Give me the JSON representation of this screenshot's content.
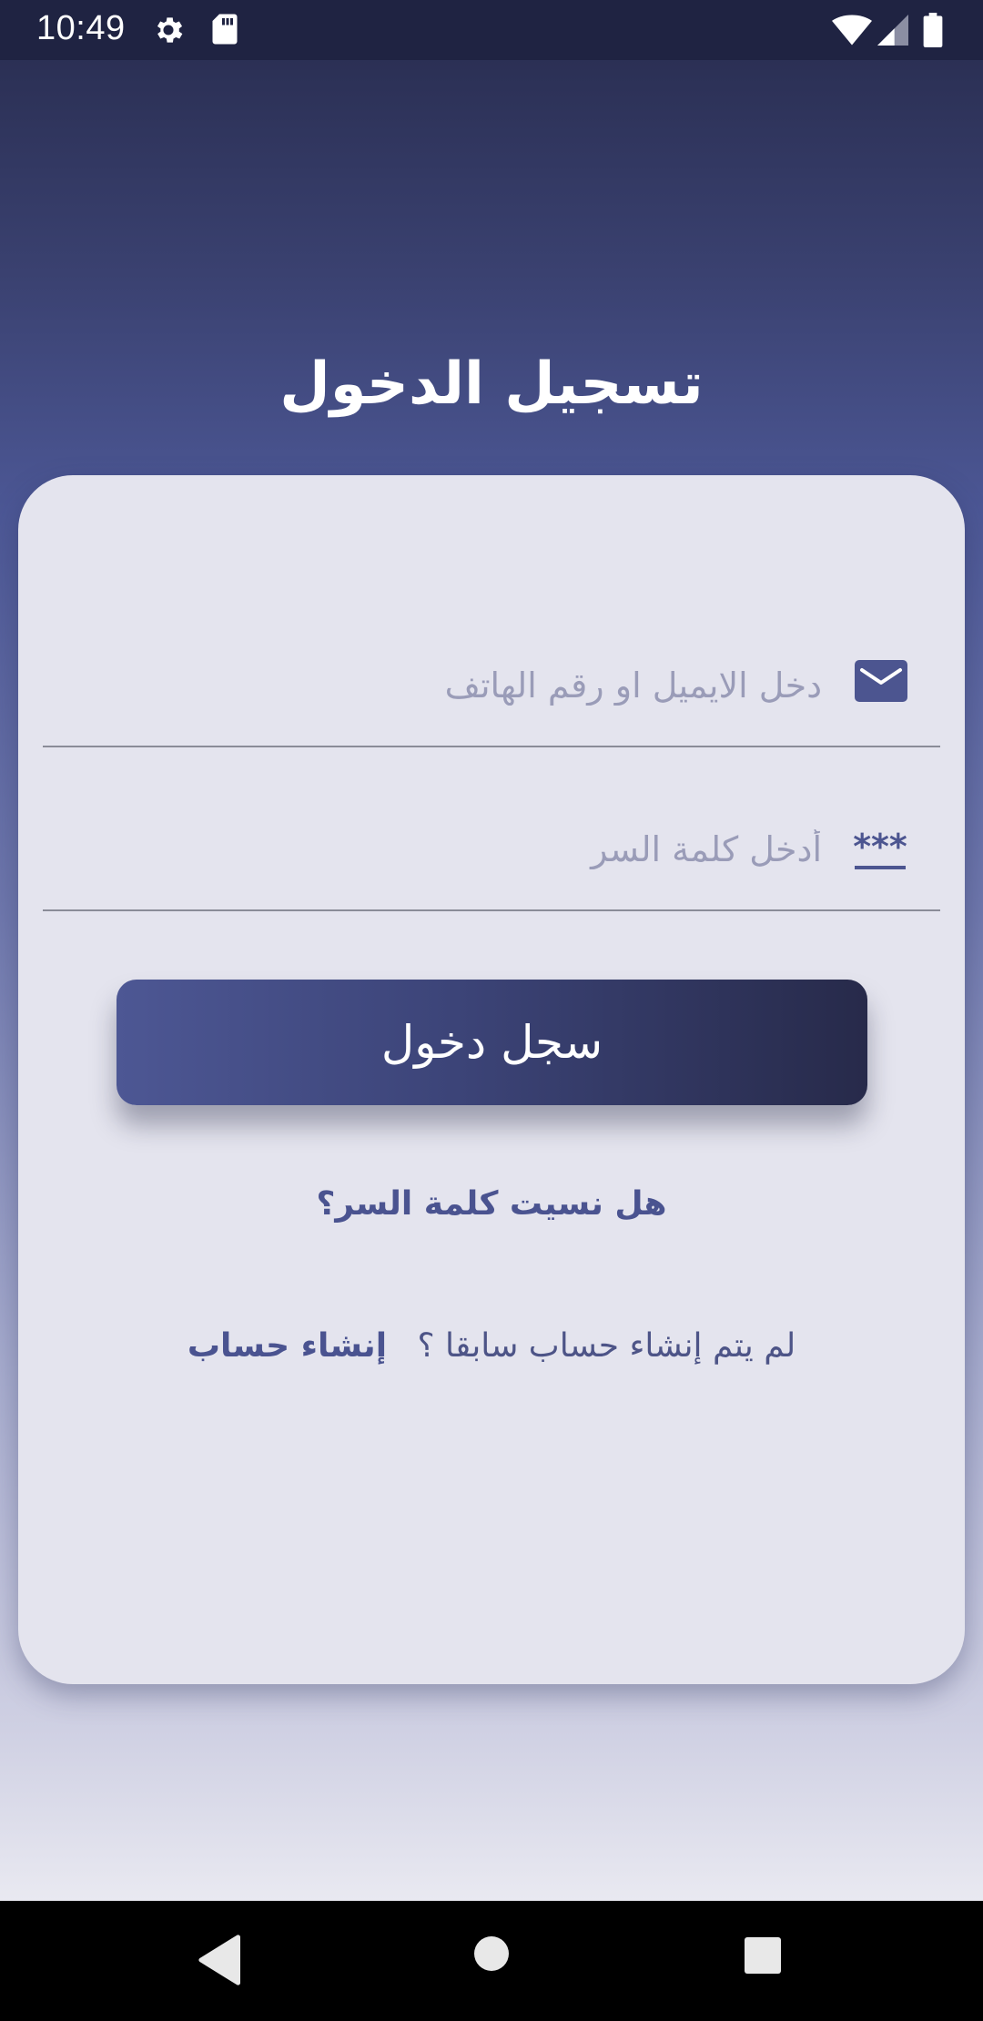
{
  "status_bar": {
    "time": "10:49",
    "icons": [
      "gear-icon",
      "sd-card-icon",
      "wifi-icon",
      "cellular-signal-icon",
      "battery-icon"
    ]
  },
  "login": {
    "title": "تسجيل الدخول",
    "email_placeholder": "دخل الايميل او رقم الهاتف",
    "email_value": "",
    "password_placeholder": "أدخل كلمة السر",
    "password_value": "",
    "password_icon_text": "***",
    "login_button": "سجل دخول",
    "forgot_password": "هل نسيت كلمة السر؟",
    "no_account_text": "لم يتم إنشاء حساب سابقا ؟",
    "create_account": "إنشاء حساب"
  },
  "nav_bar": {
    "buttons": [
      "back-icon",
      "home-icon",
      "recents-icon"
    ]
  },
  "colors": {
    "accent": "#4a5390",
    "card": "#e4e4ee",
    "button_start": "#4d5794",
    "button_end": "#272a4a"
  }
}
